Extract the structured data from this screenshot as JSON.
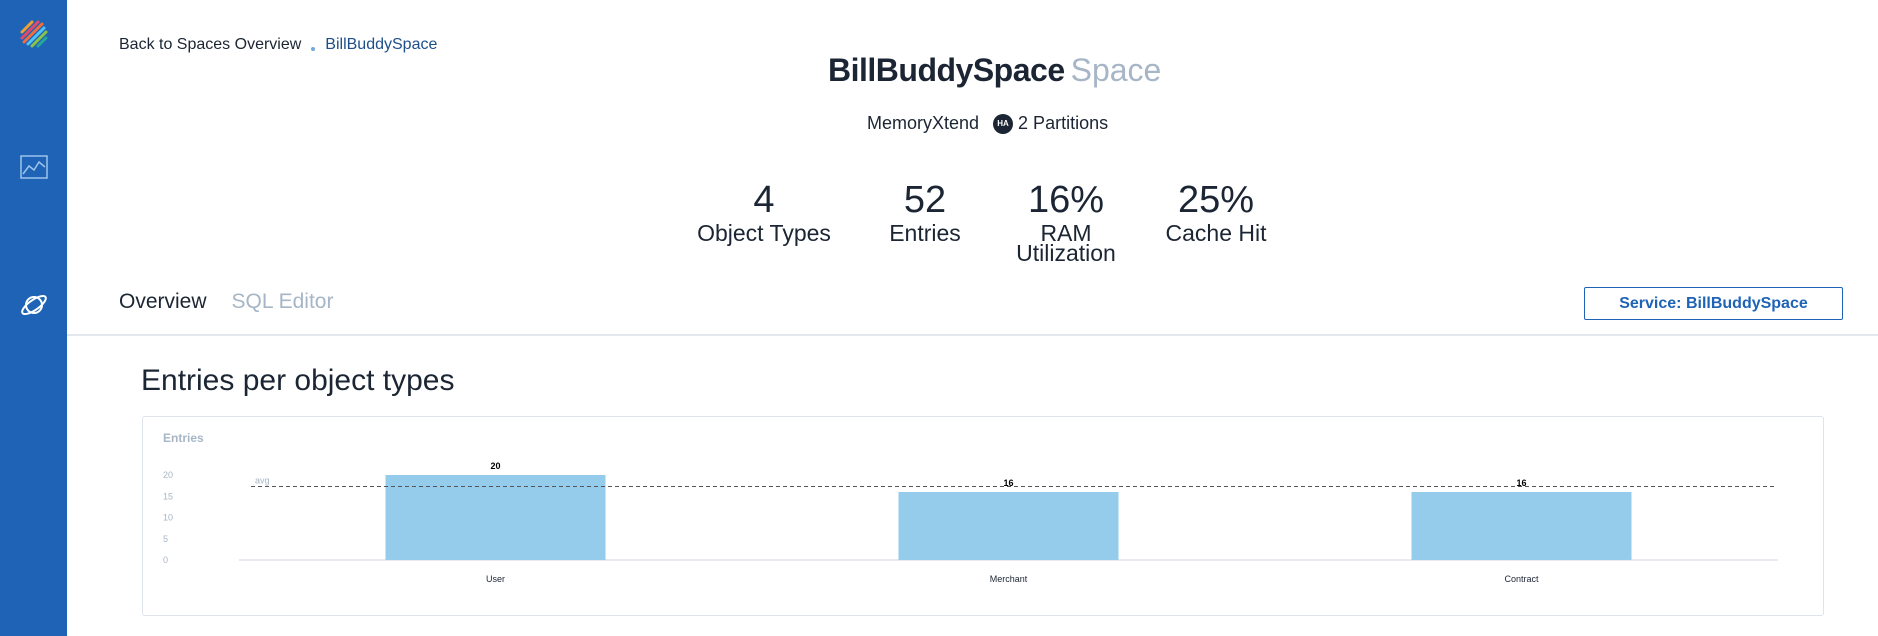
{
  "sidebar": {
    "items": [
      {
        "icon": "logo-icon"
      },
      {
        "icon": "chart-icon"
      },
      {
        "icon": "planet-icon"
      }
    ],
    "color": "#1e63b5"
  },
  "breadcrumb": {
    "back_label": "Back to Spaces Overview",
    "current": "BillBuddySpace"
  },
  "header": {
    "title": "BillBuddySpace",
    "title_suffix": "Space",
    "memory_type": "MemoryXtend",
    "badge": "HA",
    "partitions": "2 Partitions"
  },
  "stats": [
    {
      "value": "4",
      "label": "Object Types"
    },
    {
      "value": "52",
      "label": "Entries"
    },
    {
      "value": "16%",
      "label": "RAM Utilization"
    },
    {
      "value": "25%",
      "label": "Cache Hit"
    }
  ],
  "tabs": [
    {
      "label": "Overview",
      "active": true
    },
    {
      "label": "SQL Editor",
      "active": false
    }
  ],
  "service_button": "Service: BillBuddySpace",
  "section_title": "Entries per object types",
  "chart_data": {
    "type": "bar",
    "title": "Entries",
    "categories": [
      "User",
      "Merchant",
      "Contract"
    ],
    "values": [
      20,
      16,
      16
    ],
    "yticks": [
      0,
      5,
      10,
      15,
      20
    ],
    "ylim": [
      0,
      20
    ],
    "avg_value": 17.3,
    "avg_label": "avg",
    "bar_color": "#95cbeb",
    "grid": false
  }
}
